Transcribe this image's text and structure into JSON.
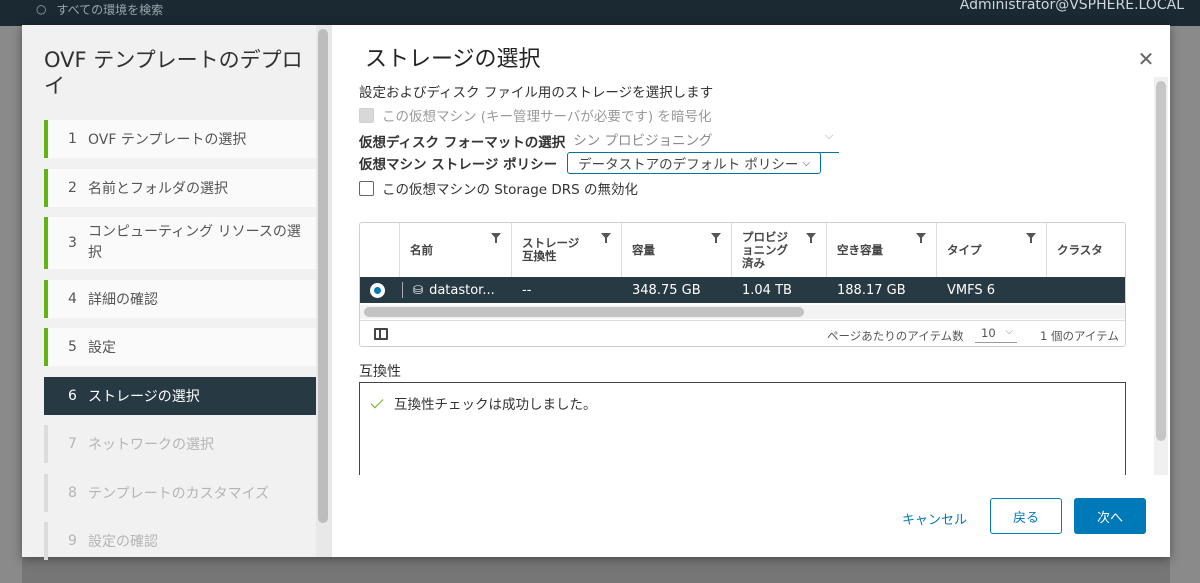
{
  "background": {
    "search_placeholder": "すべての環境を検索",
    "user": "Administrator@VSPHERE.LOCAL"
  },
  "wizard": {
    "title": "OVF テンプレートのデプロイ",
    "steps": [
      {
        "num": "1",
        "label": "OVF テンプレートの選択",
        "state": "completed"
      },
      {
        "num": "2",
        "label": "名前とフォルダの選択",
        "state": "completed"
      },
      {
        "num": "3",
        "label": "コンピューティング リソースの選択",
        "state": "completed"
      },
      {
        "num": "4",
        "label": "詳細の確認",
        "state": "completed"
      },
      {
        "num": "5",
        "label": "設定",
        "state": "completed"
      },
      {
        "num": "6",
        "label": "ストレージの選択",
        "state": "active"
      },
      {
        "num": "7",
        "label": "ネットワークの選択",
        "state": "disabled"
      },
      {
        "num": "8",
        "label": "テンプレートのカスタマイズ",
        "state": "disabled"
      },
      {
        "num": "9",
        "label": "設定の確認",
        "state": "disabled"
      }
    ]
  },
  "page": {
    "title": "ストレージの選択",
    "subtitle": "設定およびディスク ファイル用のストレージを選択します",
    "encrypt_label": "この仮想マシン (キー管理サーバが必要です) を暗号化",
    "disk_format_label": "仮想ディスク フォーマットの選択",
    "disk_format_value": "シン プロビジョニング",
    "policy_label": "仮想マシン ストレージ ポリシー",
    "policy_value": "データストアのデフォルト ポリシー",
    "sdrs_label": "この仮想マシンの Storage DRS の無効化"
  },
  "grid": {
    "columns": [
      "名前",
      "ストレージ\n互換性",
      "容量",
      "プロビジ\nョニング\n済み",
      "空き容量",
      "タイプ",
      "クラスタ"
    ],
    "rows": [
      {
        "name": "datastor...",
        "compat": "--",
        "capacity": "348.75 GB",
        "provisioned": "1.04 TB",
        "free": "188.17 GB",
        "type": "VMFS 6",
        "cluster": ""
      }
    ],
    "per_page_label": "ページあたりのアイテム数",
    "per_page_value": "10",
    "item_count": "1 個のアイテム"
  },
  "compatibility": {
    "label": "互換性",
    "message": "互換性チェックは成功しました。"
  },
  "buttons": {
    "cancel": "キャンセル",
    "back": "戻る",
    "next": "次へ"
  },
  "colors": {
    "accent": "#0079b8",
    "active_step": "#273a44",
    "completed_bar": "#60b515"
  }
}
